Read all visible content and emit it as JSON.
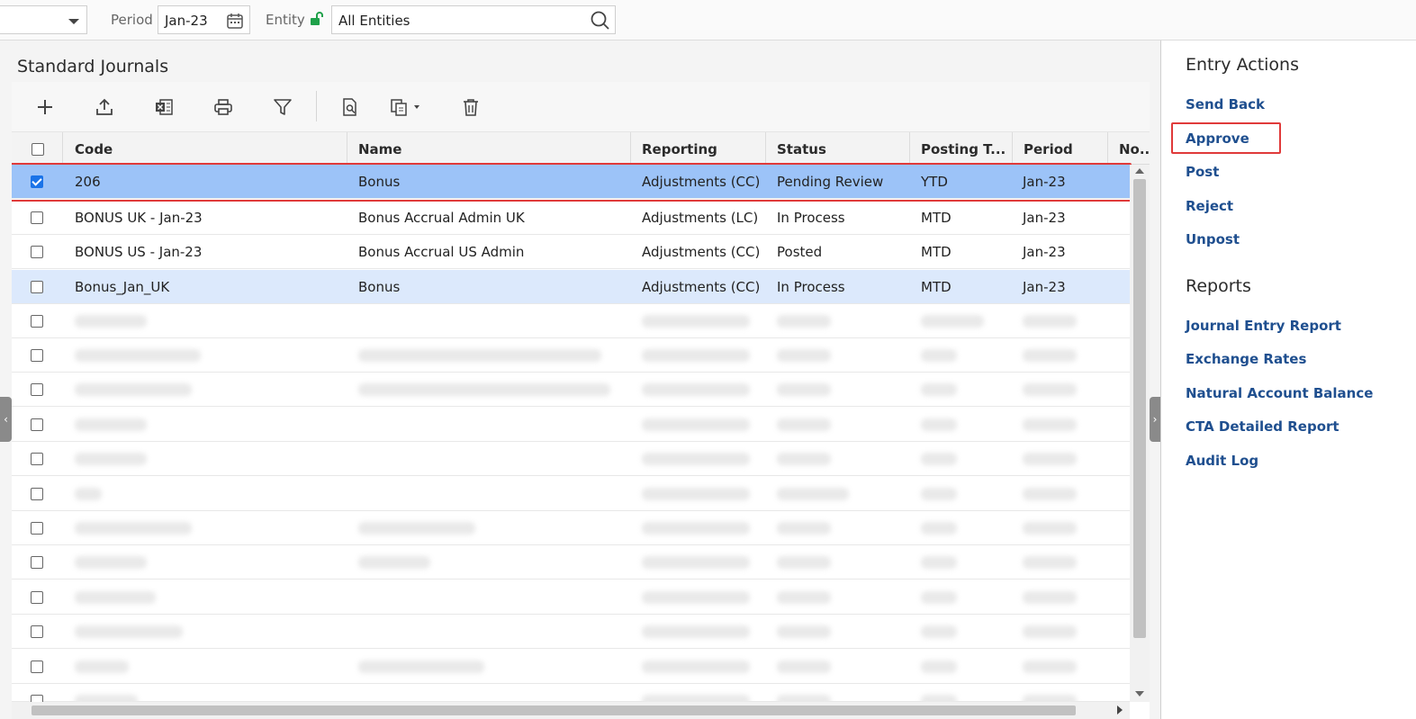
{
  "filters": {
    "period_label": "Period",
    "period_value": "Jan-23",
    "entity_label": "Entity",
    "entity_value": "All Entities"
  },
  "page": {
    "title": "Standard Journals"
  },
  "toolbar": {
    "icons": [
      "plus-icon",
      "upload-icon",
      "excel-export-icon",
      "print-icon",
      "filter-icon",
      "document-search-icon",
      "copy-icon",
      "delete-icon"
    ]
  },
  "table": {
    "headers": {
      "code": "Code",
      "name": "Name",
      "reporting": "Reporting",
      "status": "Status",
      "posting": "Posting T...",
      "period": "Period",
      "notes": "No..."
    },
    "rows": [
      {
        "code": "206",
        "name": "Bonus",
        "reporting": "Adjustments (CC)",
        "status": "Pending Review",
        "posting": "YTD",
        "period": "Jan-23",
        "checked": true
      },
      {
        "code": "BONUS UK - Jan-23",
        "name": "Bonus Accrual Admin UK",
        "reporting": "Adjustments (LC)",
        "status": "In Process",
        "posting": "MTD",
        "period": "Jan-23",
        "checked": false
      },
      {
        "code": "BONUS US - Jan-23",
        "name": "Bonus Accrual US Admin",
        "reporting": "Adjustments (CC)",
        "status": "Posted",
        "posting": "MTD",
        "period": "Jan-23",
        "checked": false
      },
      {
        "code": "Bonus_Jan_UK",
        "name": "Bonus",
        "reporting": "Adjustments (CC)",
        "status": "In Process",
        "posting": "MTD",
        "period": "Jan-23",
        "checked": false
      }
    ]
  },
  "side": {
    "entry_actions_title": "Entry Actions",
    "entry_actions": [
      "Send Back",
      "Approve",
      "Post",
      "Reject",
      "Unpost"
    ],
    "reports_title": "Reports",
    "reports": [
      "Journal Entry Report",
      "Exchange Rates",
      "Natural Account Balance",
      "CTA Detailed Report",
      "Audit Log"
    ]
  },
  "colors": {
    "selected_row": "#9cc3f8",
    "hover_row": "#dce9fc",
    "highlight": "#e03a3a",
    "link": "#1f4f8f",
    "lock": "#1fa14a"
  }
}
